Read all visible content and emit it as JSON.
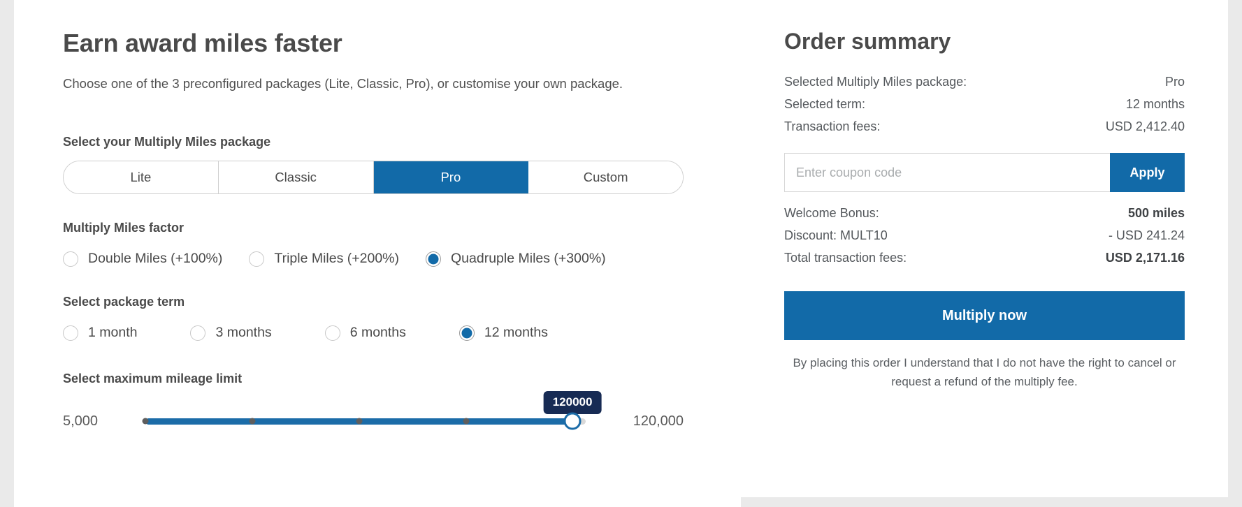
{
  "left": {
    "title": "Earn award miles faster",
    "intro": "Choose one of the 3 preconfigured packages (Lite, Classic, Pro), or customise your own package.",
    "package_section": {
      "label": "Select your Multiply Miles package",
      "options": [
        {
          "label": "Lite",
          "selected": false
        },
        {
          "label": "Classic",
          "selected": false
        },
        {
          "label": "Pro",
          "selected": true
        },
        {
          "label": "Custom",
          "selected": false
        }
      ]
    },
    "factor_section": {
      "label": "Multiply Miles factor",
      "options": [
        {
          "label": "Double Miles (+100%)",
          "selected": false
        },
        {
          "label": "Triple Miles (+200%)",
          "selected": false
        },
        {
          "label": "Quadruple Miles (+300%)",
          "selected": true
        }
      ]
    },
    "term_section": {
      "label": "Select package term",
      "options": [
        {
          "label": "1 month",
          "selected": false
        },
        {
          "label": "3 months",
          "selected": false
        },
        {
          "label": "6 months",
          "selected": false
        },
        {
          "label": "12 months",
          "selected": true
        }
      ]
    },
    "slider_section": {
      "label": "Select maximum mileage limit",
      "min_label": "5,000",
      "max_label": "120,000",
      "value_bubble": "120000"
    }
  },
  "right": {
    "title": "Order summary",
    "rows": [
      {
        "label": "Selected Multiply Miles package:",
        "value": "Pro",
        "bold": false
      },
      {
        "label": "Selected term:",
        "value": "12 months",
        "bold": false
      },
      {
        "label": "Transaction fees:",
        "value": "USD 2,412.40",
        "bold": false
      }
    ],
    "coupon": {
      "placeholder": "Enter coupon code",
      "value": "",
      "apply_label": "Apply"
    },
    "rows2": [
      {
        "label": "Welcome Bonus:",
        "value": "500 miles",
        "bold": true
      },
      {
        "label": "Discount: MULT10",
        "value": "- USD 241.24",
        "bold": false
      },
      {
        "label": "Total transaction fees:",
        "value": "USD 2,171.16",
        "bold": true
      }
    ],
    "cta_label": "Multiply now",
    "disclaimer": "By placing this order I understand that I do not have the right to cancel or request a refund of the multiply fee."
  },
  "colors": {
    "accent": "#126aa8",
    "slider_fill": "#1b6ca8",
    "bubble": "#172b54",
    "page_bg": "#eaeaea"
  }
}
